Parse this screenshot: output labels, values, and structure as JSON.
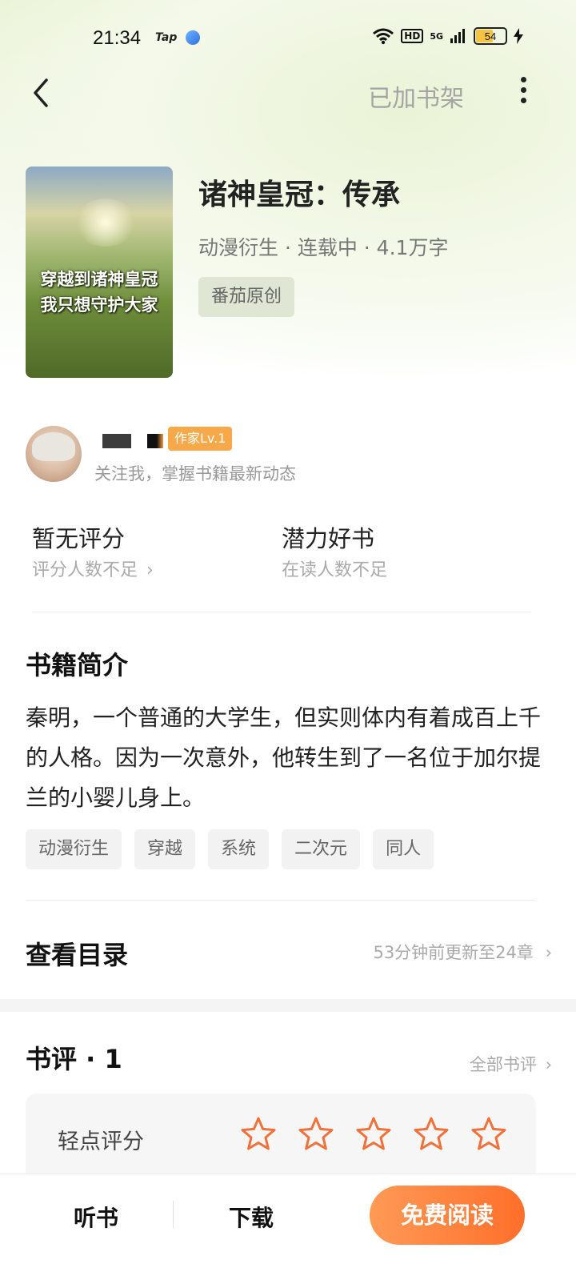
{
  "status_bar": {
    "time": "21:34",
    "app_label": "Tap",
    "network_hd": "HD",
    "network_5g": "5G",
    "battery": "54",
    "icons": [
      "wifi-icon",
      "signal-icon",
      "battery-icon",
      "charging-icon"
    ]
  },
  "nav": {
    "added_to_shelf": "已加书架"
  },
  "book": {
    "cover_text_line1": "穿越到诸神皇冠",
    "cover_text_line2": "我只想守护大家",
    "title": "诸神皇冠：传承",
    "meta": "动漫衍生 · 连载中 · 4.1万字",
    "source_tag": "番茄原创"
  },
  "author": {
    "level_badge": "作家Lv.1",
    "follow_text": "关注我，掌握书籍最新动态"
  },
  "stats": {
    "rating_title": "暂无评分",
    "rating_sub": "评分人数不足",
    "potential_title": "潜力好书",
    "potential_sub": "在读人数不足"
  },
  "intro": {
    "heading": "书籍简介",
    "text": "秦明，一个普通的大学生，但实则体内有着成百上千的人格。因为一次意外，他转生到了一名位于加尔提兰的小婴儿身上。",
    "tags": [
      "动漫衍生",
      "穿越",
      "系统",
      "二次元",
      "同人"
    ]
  },
  "toc": {
    "heading": "查看目录",
    "update": "53分钟前更新至24章"
  },
  "reviews": {
    "heading": "书评 · 1",
    "all": "全部书评",
    "rate_label": "轻点评分"
  },
  "bottom_bar": {
    "listen": "听书",
    "download": "下载",
    "read": "免费阅读"
  },
  "colors": {
    "accent": "#ff7a35",
    "star": "#f2703a",
    "header_tint": "#e9f3d4"
  }
}
